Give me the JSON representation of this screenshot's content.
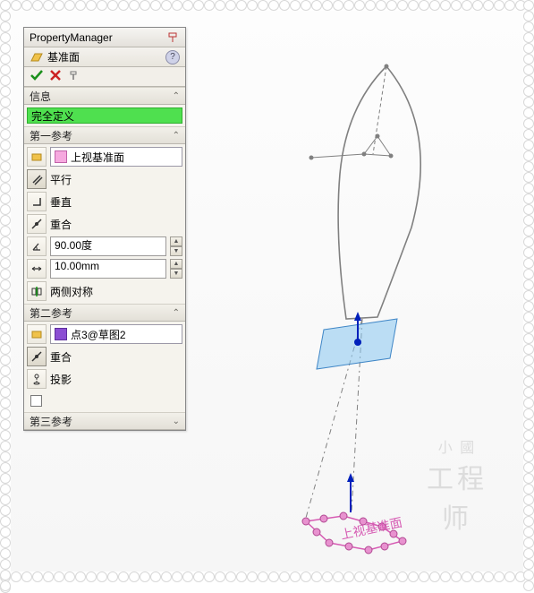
{
  "title": "PropertyManager",
  "feature": {
    "name": "基准面"
  },
  "sections": {
    "info": {
      "header": "信息",
      "status": "完全定义"
    },
    "ref1": {
      "header": "第一参考",
      "selection": "上视基准面",
      "opts": {
        "parallel": "平行",
        "perp": "垂直",
        "coincident": "重合",
        "angle": "90.00度",
        "distance": "10.00mm",
        "midplane": "两侧对称"
      }
    },
    "ref2": {
      "header": "第二参考",
      "selection": "点3@草图2",
      "opts": {
        "coincident": "重合",
        "project": "投影"
      }
    },
    "ref3": {
      "header": "第三参考"
    }
  },
  "colors": {
    "panel_bg": "#eceae6",
    "status_ok": "#4fe04f",
    "swatch_pink": "#f6a9df",
    "swatch_purple": "#8b4ed3",
    "plane_preview": "#89c6f0"
  },
  "viewport": {
    "datum_label": "上视基准面"
  }
}
